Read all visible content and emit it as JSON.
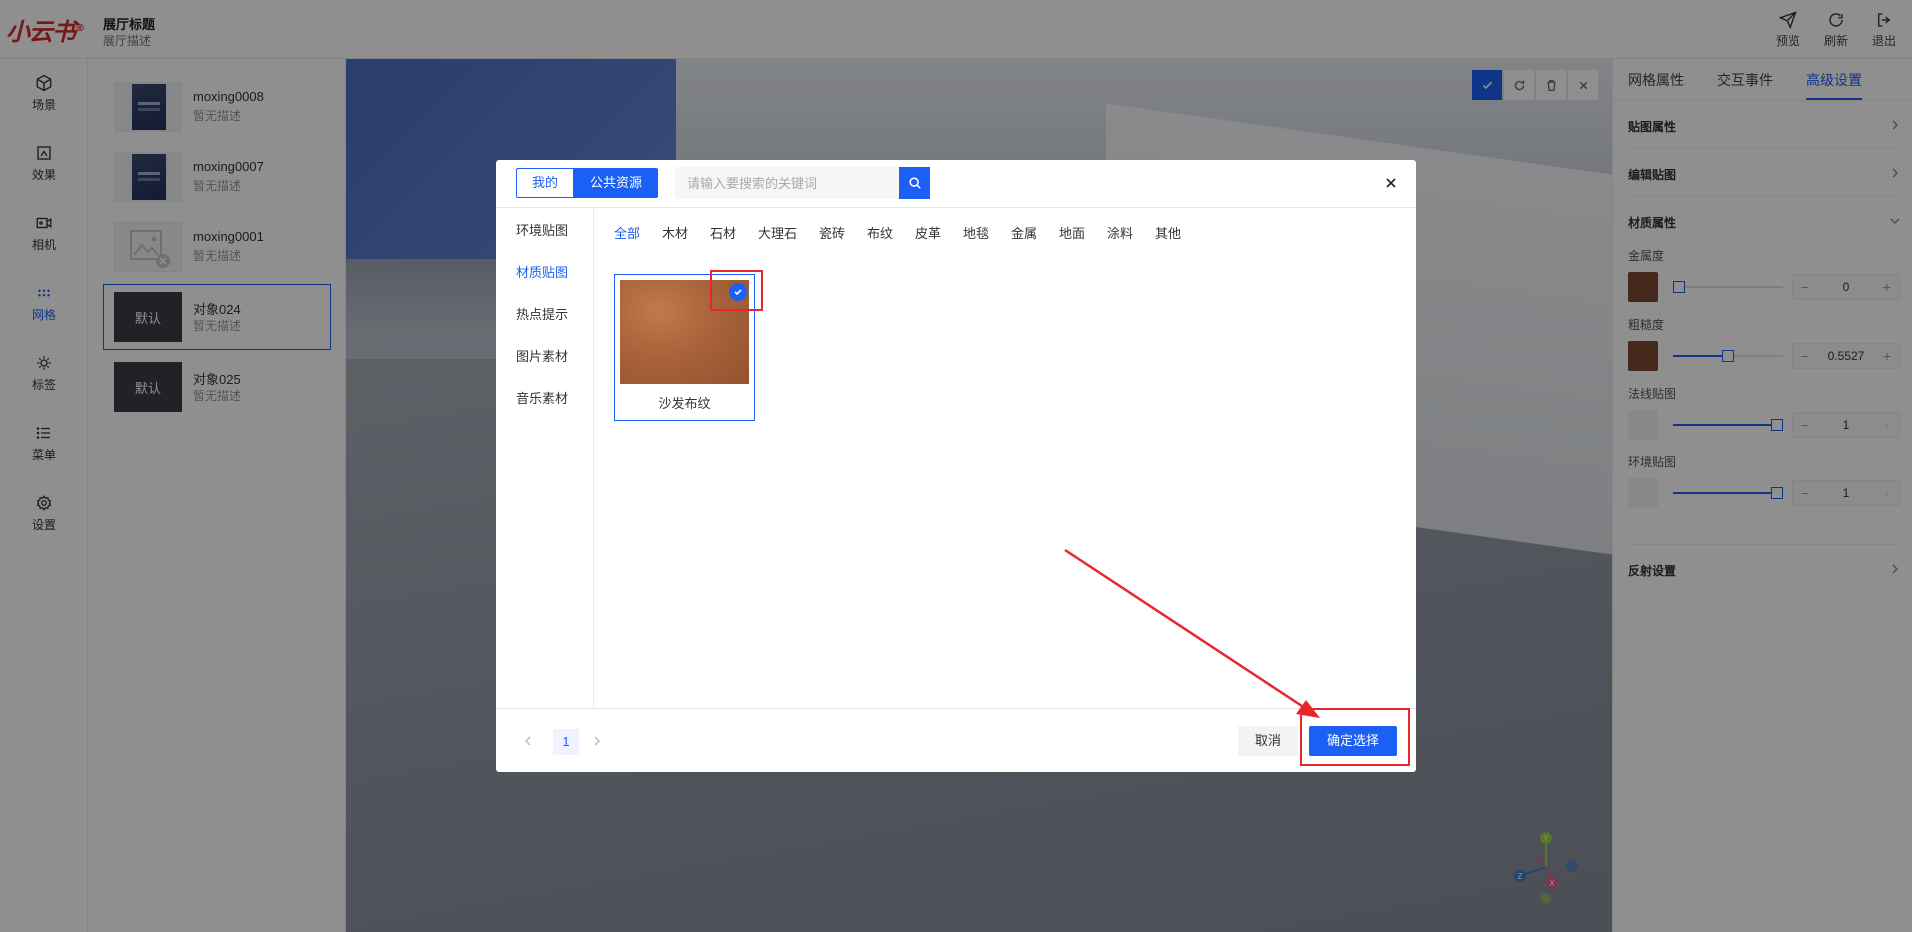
{
  "app": {
    "logo": "小云书",
    "logo_mark": "®",
    "hall_title": "展厅标题",
    "hall_desc": "展厅描述",
    "actions": [
      {
        "label": "预览",
        "icon": "send-icon"
      },
      {
        "label": "刷新",
        "icon": "refresh-icon"
      },
      {
        "label": "退出",
        "icon": "logout-icon"
      }
    ]
  },
  "nav": {
    "items": [
      {
        "label": "场景",
        "icon": "cube-icon"
      },
      {
        "label": "效果",
        "icon": "image-effect-icon"
      },
      {
        "label": "相机",
        "icon": "camera-icon"
      },
      {
        "label": "网格",
        "icon": "grid-dots-icon",
        "active": true
      },
      {
        "label": "标签",
        "icon": "target-icon"
      },
      {
        "label": "菜单",
        "icon": "list-icon"
      },
      {
        "label": "设置",
        "icon": "gear-icon"
      }
    ]
  },
  "objects": [
    {
      "name": "moxing0008",
      "desc": "暂无描述",
      "thumb": "book"
    },
    {
      "name": "moxing0007",
      "desc": "暂无描述",
      "thumb": "book"
    },
    {
      "name": "moxing0001",
      "desc": "暂无描述",
      "thumb": "broken-image"
    },
    {
      "name": "对象024",
      "desc": "暂无描述",
      "thumb_text": "默认",
      "selected": true
    },
    {
      "name": "对象025",
      "desc": "暂无描述",
      "thumb_text": "默认"
    }
  ],
  "right_panel": {
    "tabs": [
      "网格属性",
      "交互事件",
      "高级设置"
    ],
    "active_tab": "高级设置",
    "sections": {
      "texture_props": "贴图属性",
      "edit_texture": "编辑贴图",
      "material_props": "材质属性",
      "reflection": "反射设置"
    },
    "fields": [
      {
        "label": "金属度",
        "value": "0",
        "slider": 0.0,
        "swatch": "#7b4a32"
      },
      {
        "label": "粗糙度",
        "value": "0.5527",
        "slider": 0.5527,
        "swatch": "#7b4a32"
      },
      {
        "label": "法线贴图",
        "value": "1",
        "slider": 1.0,
        "swatch": "#f2f2f2"
      },
      {
        "label": "环境贴图",
        "value": "1",
        "slider": 1.0,
        "swatch": "#f2f2f2"
      }
    ]
  },
  "viewport": {
    "tools": [
      "check-icon",
      "refresh-icon",
      "trash-icon",
      "close-icon"
    ]
  },
  "modal": {
    "tab_mine": "我的",
    "tab_public": "公共资源",
    "search_placeholder": "请输入要搜索的关键词",
    "sidebar": [
      "环境贴图",
      "材质贴图",
      "热点提示",
      "图片素材",
      "音乐素材"
    ],
    "sidebar_active": "材质贴图",
    "categories": [
      "全部",
      "木材",
      "石材",
      "大理石",
      "瓷砖",
      "布纹",
      "皮革",
      "地毯",
      "金属",
      "地面",
      "涂料",
      "其他"
    ],
    "category_active": "全部",
    "items": [
      {
        "label": "沙发布纹",
        "selected": true,
        "color": "#a9623a"
      }
    ],
    "page": "1",
    "cancel": "取消",
    "confirm": "确定选择"
  },
  "colors": {
    "primary": "#1c5ff5",
    "annotation": "#e8272b"
  }
}
